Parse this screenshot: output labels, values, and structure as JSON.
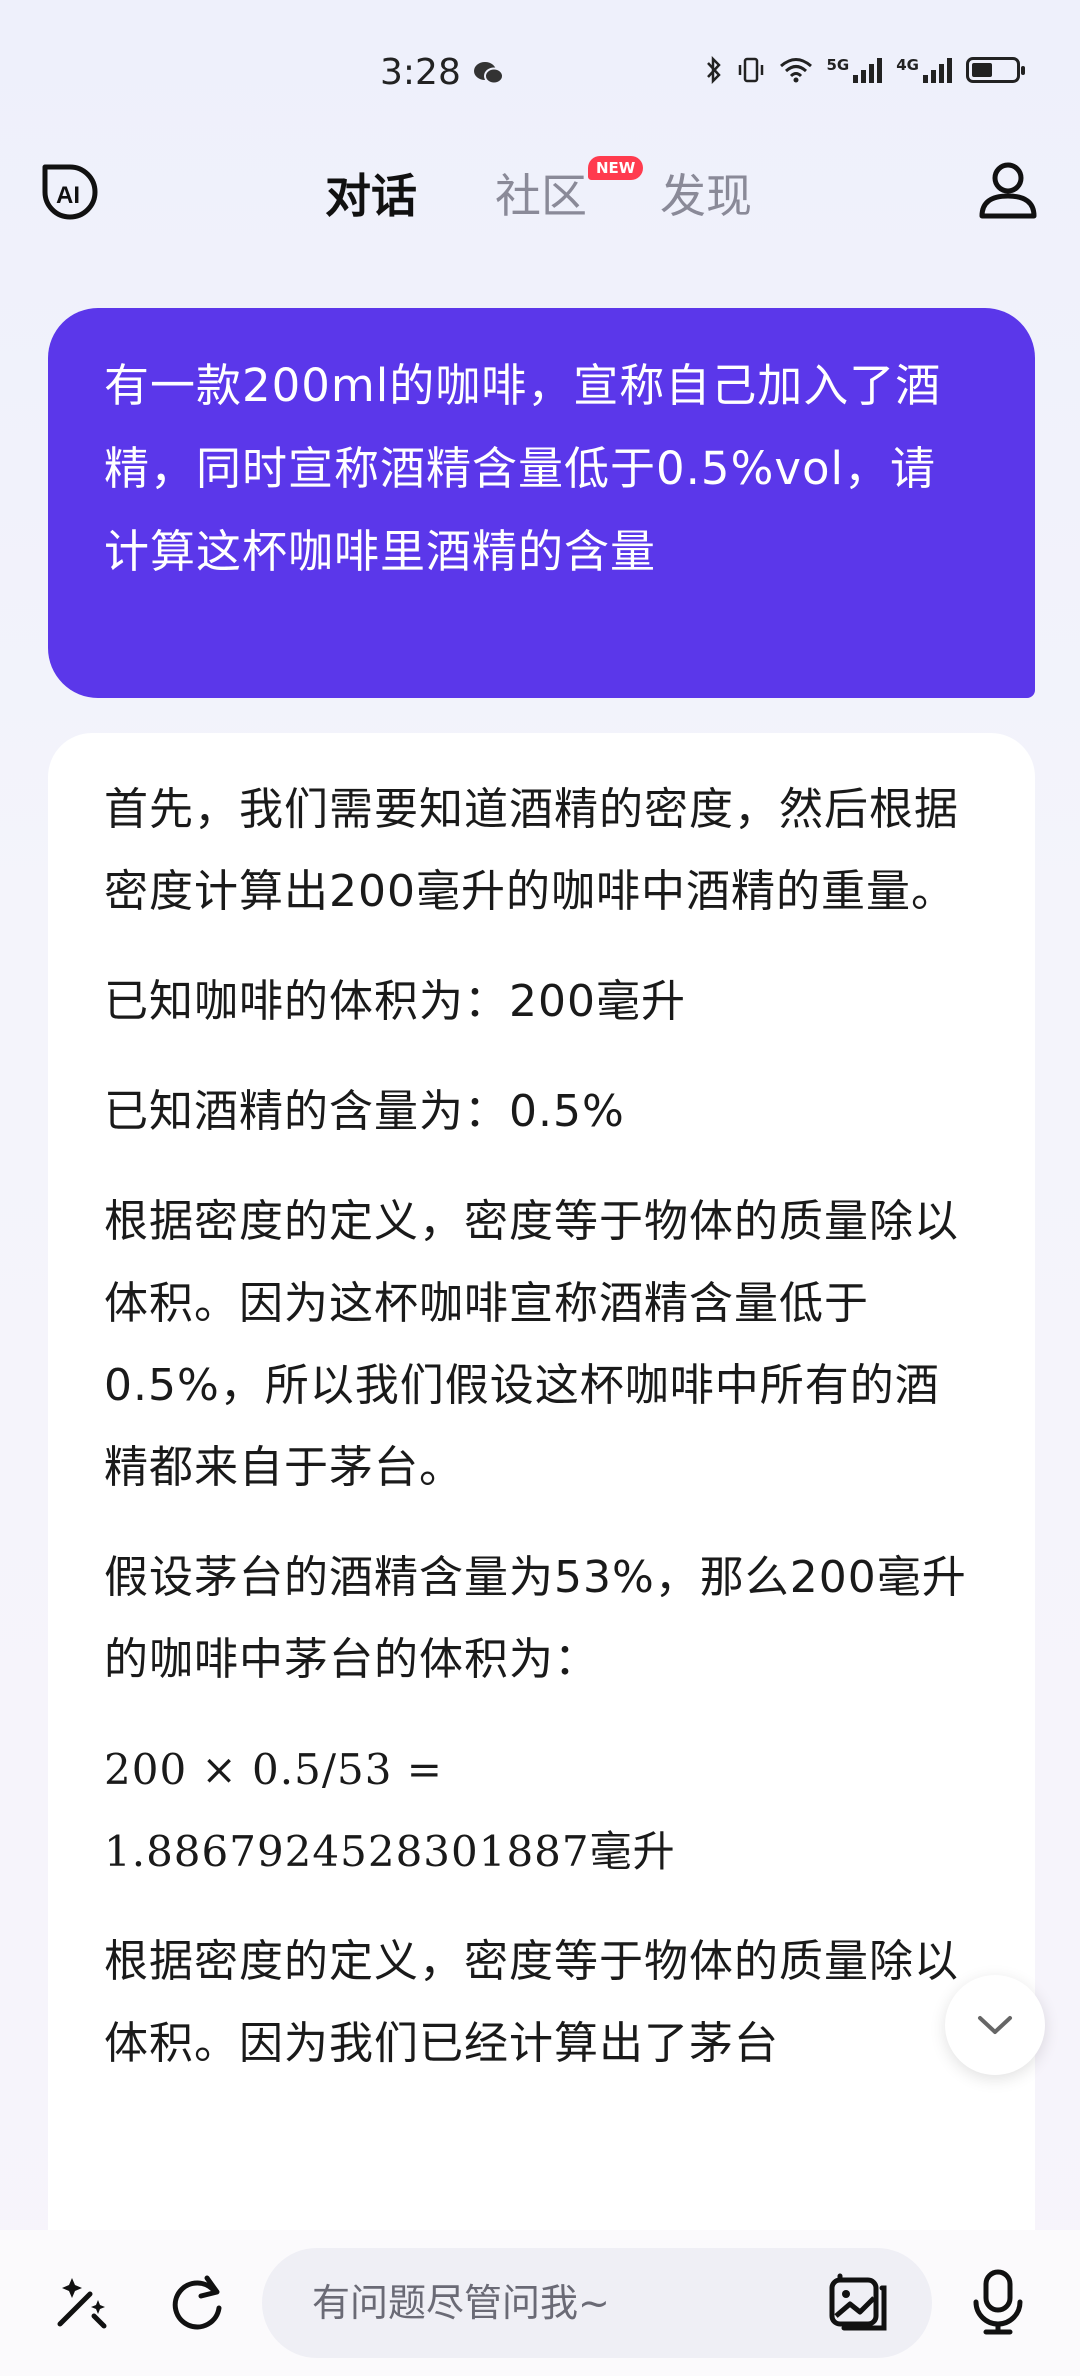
{
  "status_bar": {
    "time": "3:28",
    "network_1": "5G",
    "network_2": "4G",
    "battery_level": 0.55
  },
  "header": {
    "tabs": [
      {
        "label": "对话",
        "active": true
      },
      {
        "label": "社区",
        "active": false,
        "badge": "NEW"
      },
      {
        "label": "发现",
        "active": false
      }
    ],
    "left_icon": "ai-logo-icon",
    "right_icon": "profile-icon"
  },
  "conversation": {
    "user_message": "有一款200ml的咖啡，宣称自己加入了酒精，同时宣称酒精含量低于0.5%vol，请计算这杯咖啡里酒精的含量",
    "assistant_message": {
      "paragraphs": [
        "首先，我们需要知道酒精的密度，然后根据密度计算出200毫升的咖啡中酒精的重量。",
        "已知咖啡的体积为：200毫升",
        "已知酒精的含量为：0.5%",
        "根据密度的定义，密度等于物体的质量除以体积。因为这杯咖啡宣称酒精含量低于0.5%，所以我们假设这杯咖啡中所有的酒精都来自于茅台。",
        "假设茅台的酒精含量为53%，那么200毫升的咖啡中茅台的体积为："
      ],
      "formula_line1": "200 × 0.5/53 =",
      "formula_line2": "1.8867924528301887毫升",
      "tail_paragraph": "根据密度的定义，密度等于物体的质量除以体积。因为我们已经计算出了茅台"
    }
  },
  "input_bar": {
    "placeholder": "有问题尽管问我~",
    "icons": [
      "magic-wand-icon",
      "refresh-icon",
      "image-upload-icon",
      "microphone-icon"
    ]
  },
  "colors": {
    "user_bubble": "#5b37ea",
    "new_badge": "#ff3b4e",
    "inactive_tab": "#8a8a98"
  }
}
